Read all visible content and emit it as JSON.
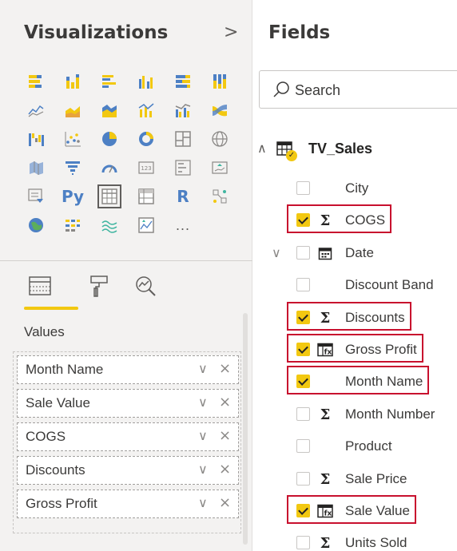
{
  "visualizations": {
    "title": "Visualizations",
    "collapse_glyph": ">",
    "icons": [
      "stacked-bar-chart-icon",
      "stacked-column-chart-icon",
      "clustered-bar-chart-icon",
      "clustered-column-chart-icon",
      "100-percent-stacked-bar-chart-icon",
      "100-percent-stacked-column-chart-icon",
      "line-chart-icon",
      "area-chart-icon",
      "stacked-area-chart-icon",
      "line-and-stacked-column-chart-icon",
      "line-and-clustered-column-chart-icon",
      "ribbon-chart-icon",
      "waterfall-chart-icon",
      "scatter-chart-icon",
      "pie-chart-icon",
      "donut-chart-icon",
      "treemap-icon",
      "map-icon",
      "filled-map-icon",
      "funnel-icon",
      "gauge-icon",
      "card-icon",
      "multi-row-card-icon",
      "kpi-icon",
      "slicer-icon",
      "python-visual-icon",
      "table-visual-icon",
      "matrix-icon",
      "r-visual-icon",
      "key-influencers-icon",
      "arcgis-map-icon",
      "decomposition-tree-icon",
      "qa-icon",
      "custom-visual-icon",
      "more-visuals-icon"
    ],
    "python_label": "Py",
    "r_label": "R",
    "more_label": "...",
    "selected_icon": "table-visual-icon",
    "values_label": "Values",
    "value_fields": [
      {
        "label": "Month Name",
        "chevron": "∨",
        "remove": "×"
      },
      {
        "label": "Sale Value",
        "chevron": "∨",
        "remove": "×"
      },
      {
        "label": "COGS",
        "chevron": "∨",
        "remove": "×"
      },
      {
        "label": "Discounts",
        "chevron": "∨",
        "remove": "×"
      },
      {
        "label": "Gross Profit",
        "chevron": "∨",
        "remove": "×"
      }
    ]
  },
  "fields": {
    "title": "Fields",
    "search_placeholder": "Search",
    "table": {
      "name": "TV_Sales",
      "collapse_glyph": "∧"
    },
    "items": [
      {
        "name": "City",
        "checked": false,
        "type": "none",
        "highlighted": false
      },
      {
        "name": "COGS",
        "checked": true,
        "type": "sum",
        "highlighted": true
      },
      {
        "name": "Date",
        "checked": false,
        "type": "date",
        "highlighted": false,
        "expandable": true
      },
      {
        "name": "Discount Band",
        "checked": false,
        "type": "none",
        "highlighted": false
      },
      {
        "name": "Discounts",
        "checked": true,
        "type": "sum",
        "highlighted": true
      },
      {
        "name": "Gross Profit",
        "checked": true,
        "type": "calc",
        "highlighted": true
      },
      {
        "name": "Month Name",
        "checked": true,
        "type": "none",
        "highlighted": true
      },
      {
        "name": "Month Number",
        "checked": false,
        "type": "sum",
        "highlighted": false
      },
      {
        "name": "Product",
        "checked": false,
        "type": "none",
        "highlighted": false
      },
      {
        "name": "Sale Price",
        "checked": false,
        "type": "sum",
        "highlighted": false
      },
      {
        "name": "Sale Value",
        "checked": true,
        "type": "calc",
        "highlighted": true
      },
      {
        "name": "Units Sold",
        "checked": false,
        "type": "sum",
        "highlighted": false
      }
    ],
    "sigma_glyph": "Σ",
    "expand_glyph": "∨"
  },
  "colors": {
    "accent_yellow": "#f2c811",
    "highlight_red": "#c8102e",
    "pane_bg": "#f3f2f1"
  }
}
